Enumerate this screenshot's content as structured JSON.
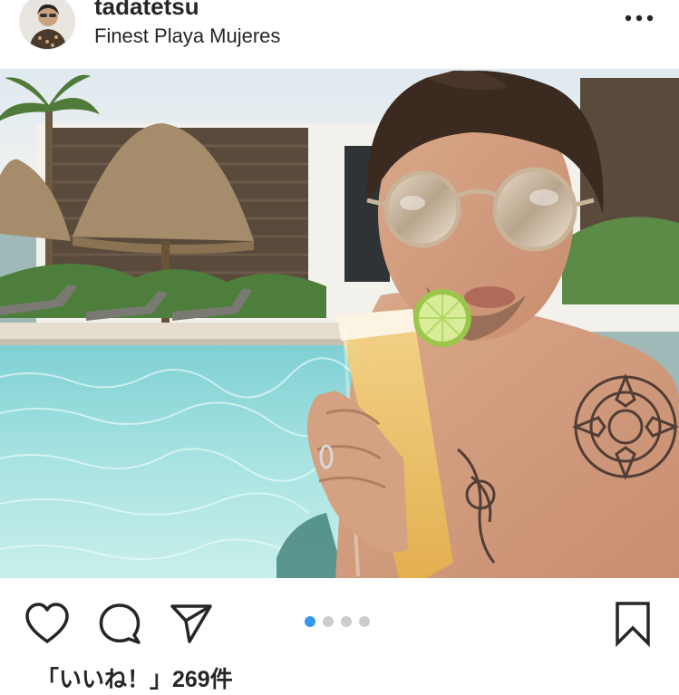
{
  "post": {
    "username": "tadatetsu",
    "location": "Finest Playa Mujeres",
    "likes_text": "「いいね！」269件"
  },
  "header": {
    "more_icon": "more-horizontal-icon"
  },
  "actions": {
    "icons": [
      "heart-icon",
      "comment-icon",
      "share-icon",
      "bookmark-icon"
    ]
  },
  "carousel": {
    "total": 4,
    "active_index": 0,
    "active_color": "#3897f0",
    "inactive_color": "#cdcdcd"
  }
}
